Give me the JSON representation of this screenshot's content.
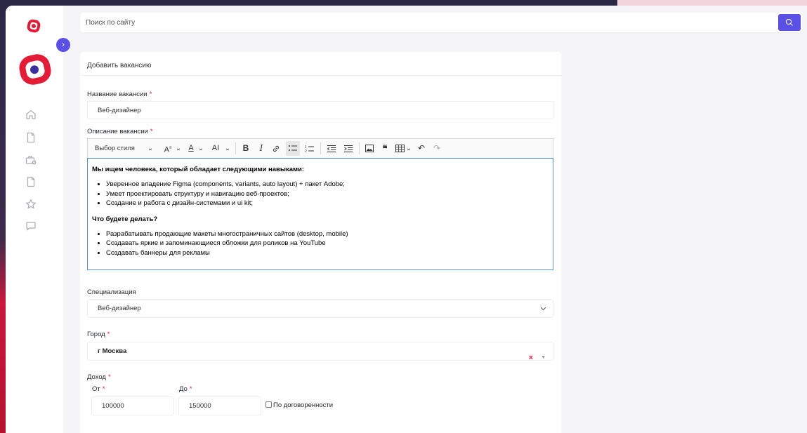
{
  "search": {
    "placeholder": "Поиск по сайту"
  },
  "card": {
    "header": "Добавить вакансию",
    "vacancy_name": {
      "label": "Название вакансии",
      "required_mark": "*",
      "value": "Веб-дизайнер"
    },
    "description": {
      "label": "Описание вакансии",
      "required_mark": "*",
      "toolbar": {
        "style_select": "Выбор стиля",
        "bold": "B",
        "italic": "I"
      },
      "intro": "Мы ищем человека, который обладает следующими навыками:",
      "skills": [
        "Уверенное владение Figma (components, variants, auto layout) + пакет Adobe;",
        "Умеет проектировать структуру и навигацию веб-проектов;",
        "Создание и работа с дизайн-системами и ui kit;"
      ],
      "tasks_heading": "Что будете делать?",
      "tasks": [
        "Разрабатывать продающие макеты многостраничных сайтов (desktop, mobile)",
        "Создавать яркие и запоминающиеся обложки для роликов на YouTube",
        "Создавать баннеры для рекламы"
      ]
    },
    "specialization": {
      "label": "Специализация",
      "value": "Веб-дизайнер"
    },
    "city": {
      "label": "Город",
      "required_mark": "*",
      "value": "г Москва",
      "clear": "×",
      "caret": "▼"
    },
    "income": {
      "label": "Доход",
      "required_mark": "*",
      "from_label": "От",
      "from_value": "100000",
      "to_label": "До",
      "to_value": "150000",
      "negotiable_label": "По договоренности"
    }
  },
  "sidebar": {
    "expand_glyph": "›",
    "icons": [
      "home-icon",
      "document-icon",
      "briefcase-icon",
      "file-icon",
      "star-icon",
      "chat-icon"
    ]
  },
  "colors": {
    "accent": "#5b50e6",
    "brand_red": "#e31b37",
    "editor_focus": "#5a8ed6"
  }
}
